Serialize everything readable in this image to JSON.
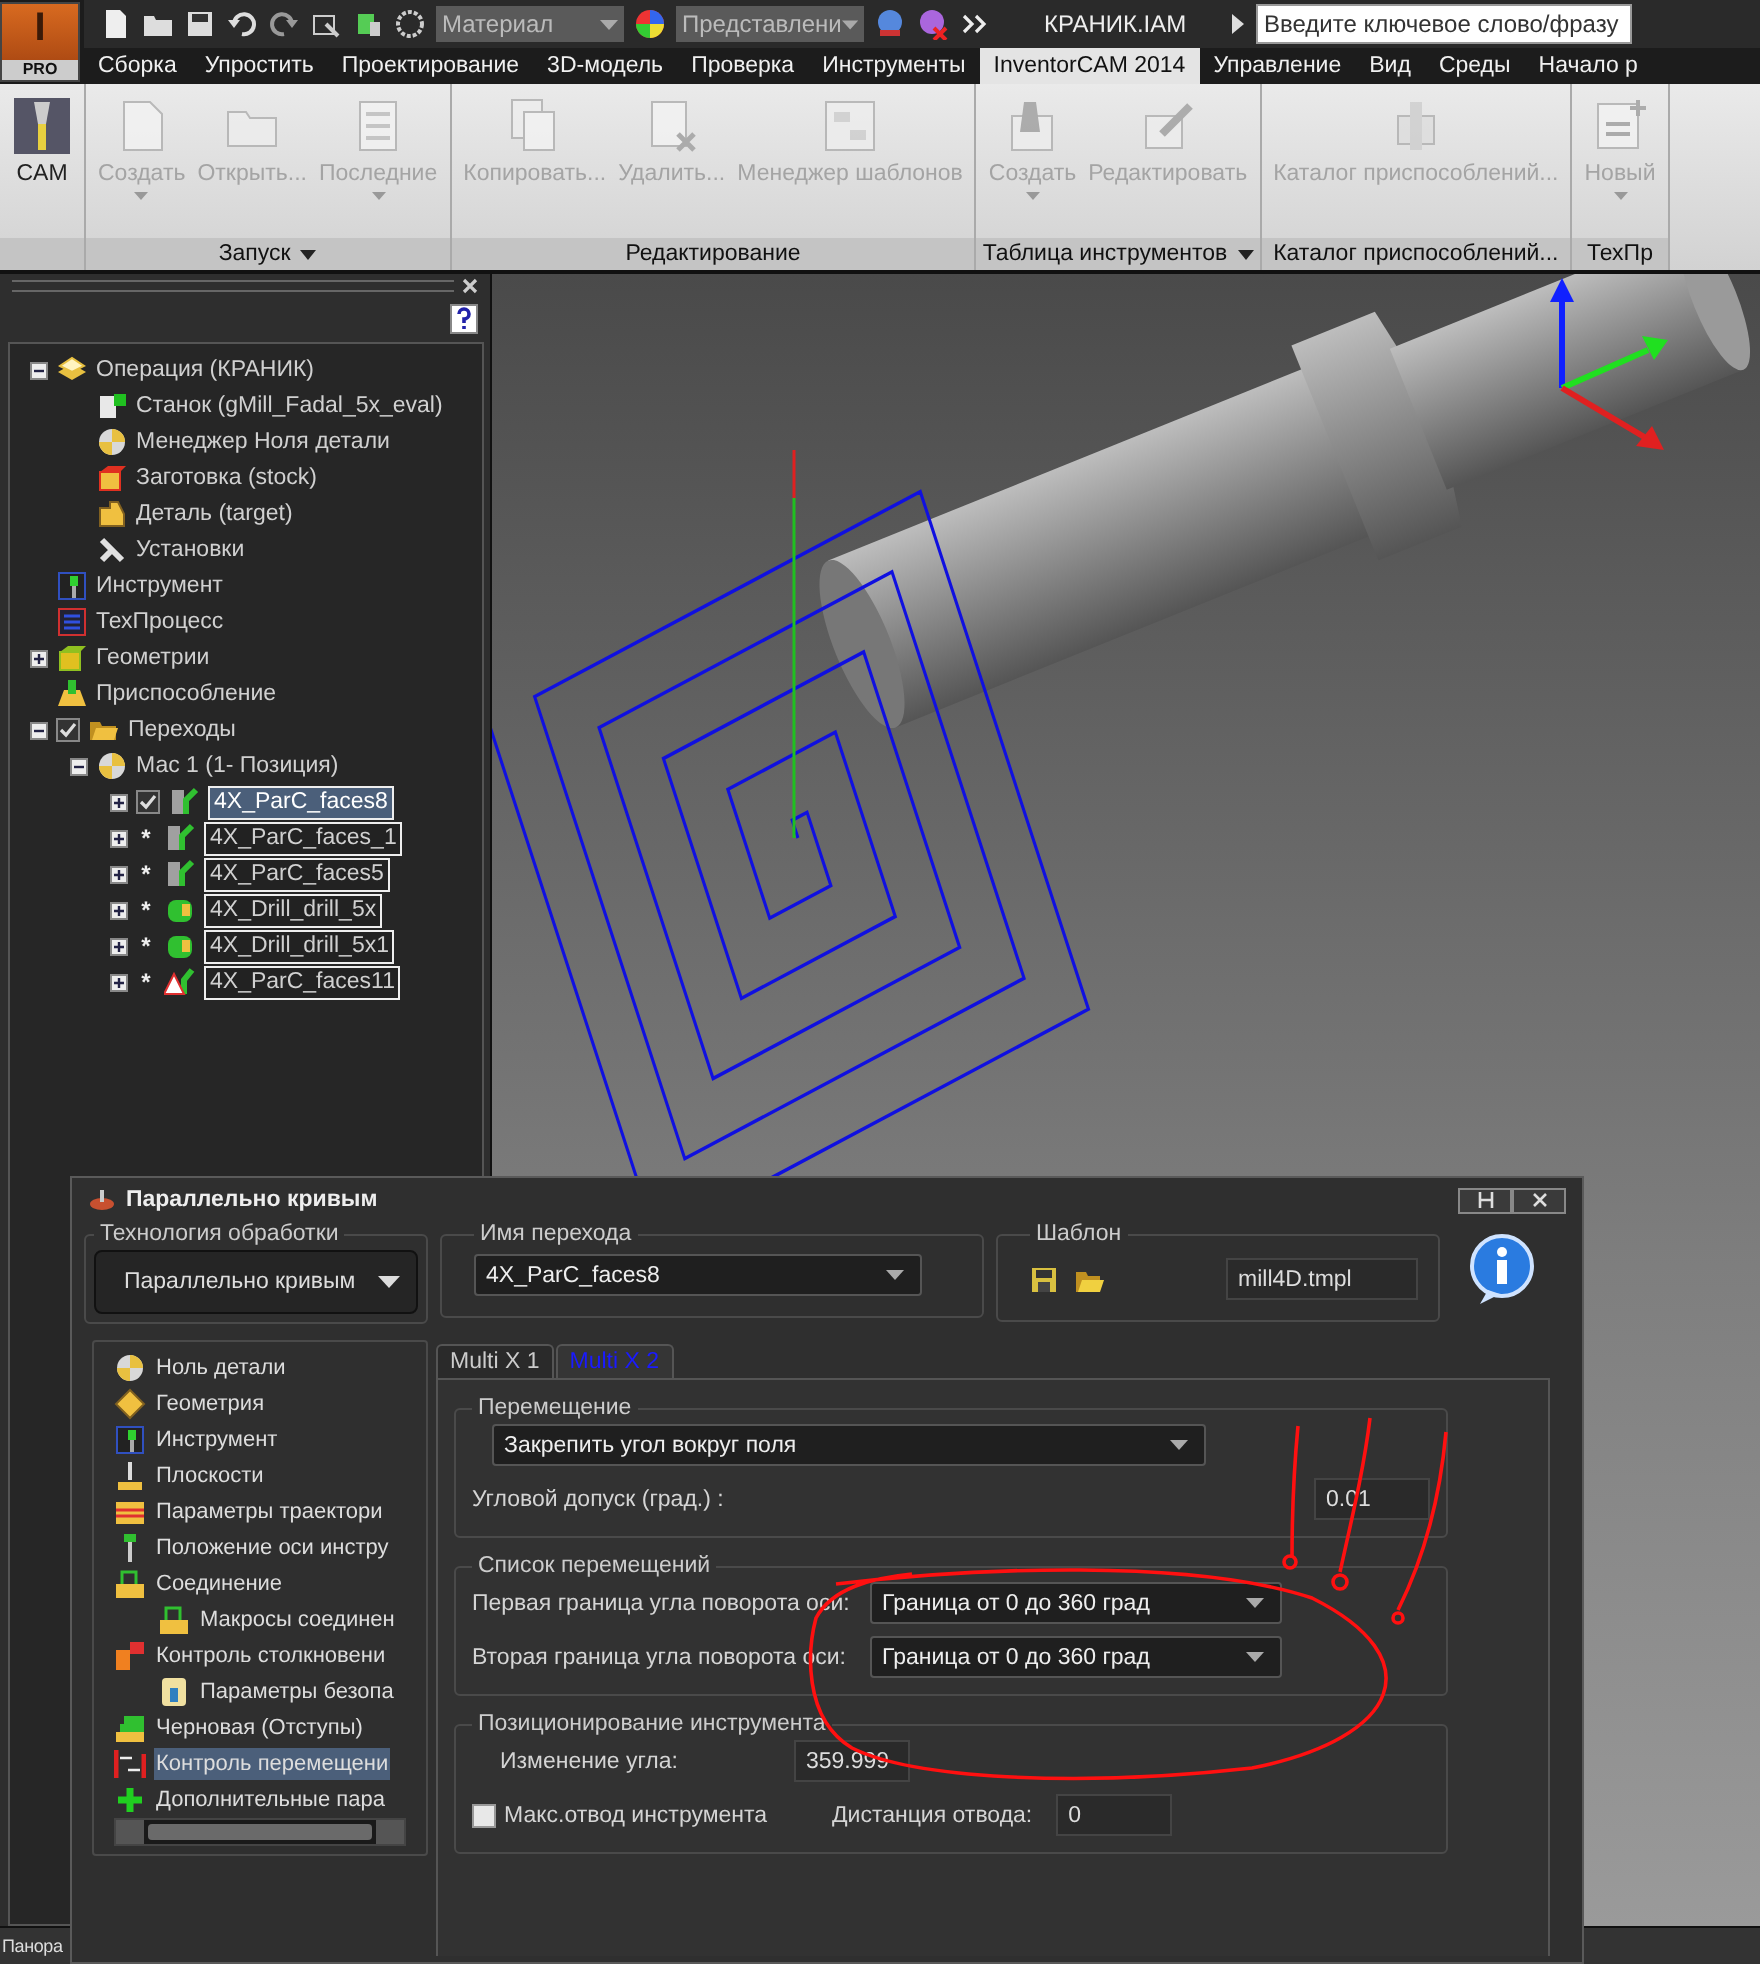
{
  "app_header": {
    "logo_letter": "I",
    "logo_badge": "PRO",
    "material": "Материал",
    "representation": "Представлени",
    "document_title": "КРАНИК.IAM",
    "search": {
      "placeholder": "Введите ключевое слово/фразу"
    }
  },
  "ribbon_tabs": [
    {
      "label": "Сборка",
      "selected": false
    },
    {
      "label": "Упростить",
      "selected": false
    },
    {
      "label": "Проектирование",
      "selected": false
    },
    {
      "label": "3D-модель",
      "selected": false
    },
    {
      "label": "Проверка",
      "selected": false
    },
    {
      "label": "Инструменты",
      "selected": false
    },
    {
      "label": "InventorCAM 2014",
      "selected": true
    },
    {
      "label": "Управление",
      "selected": false
    },
    {
      "label": "Вид",
      "selected": false
    },
    {
      "label": "Среды",
      "selected": false
    },
    {
      "label": "Начало р",
      "selected": false
    }
  ],
  "ribbon_groups": [
    {
      "buttons": [
        {
          "label": "CAM",
          "kind": "cam",
          "disabled": false,
          "dropdown": false
        }
      ]
    },
    {
      "label": "Запуск",
      "menu": true,
      "buttons": [
        {
          "label": "Создать",
          "kind": "document",
          "disabled": true,
          "dropdown": true
        },
        {
          "label": "Открыть...",
          "kind": "folder",
          "disabled": true,
          "dropdown": false
        },
        {
          "label": "Последние",
          "kind": "list",
          "disabled": true,
          "dropdown": true
        }
      ]
    },
    {
      "label": "Редактирование",
      "menu": false,
      "buttons": [
        {
          "label": "Копировать...",
          "kind": "copy",
          "disabled": true,
          "dropdown": false
        },
        {
          "label": "Удалить...",
          "kind": "delete",
          "disabled": true,
          "dropdown": false
        },
        {
          "label": "Менеджер шаблонов",
          "kind": "template",
          "disabled": true,
          "dropdown": false
        }
      ]
    },
    {
      "label": "Таблица инструментов",
      "menu": true,
      "buttons": [
        {
          "label": "Создать",
          "kind": "tool",
          "disabled": true,
          "dropdown": true
        },
        {
          "label": "Редактировать",
          "kind": "edit",
          "disabled": true,
          "dropdown": false
        }
      ]
    },
    {
      "label": "Каталог приспособлений...",
      "menu": false,
      "buttons": [
        {
          "label": "Каталог приспособлений...",
          "kind": "fixture",
          "disabled": true,
          "dropdown": false
        }
      ]
    },
    {
      "label": "ТехПр",
      "menu": false,
      "buttons": [
        {
          "label": "Новый",
          "kind": "new",
          "disabled": true,
          "dropdown": true
        }
      ]
    }
  ],
  "browser": {
    "tree": [
      {
        "label": "Операция (КРАНИК)",
        "kind": "operation",
        "expanded": true,
        "children": [
          {
            "label": "Станок (gMill_Fadal_5x_eval)",
            "kind": "machine"
          },
          {
            "label": "Менеджер Ноля детали",
            "kind": "zero"
          },
          {
            "label": "Заготовка (stock)",
            "kind": "stock"
          },
          {
            "label": "Деталь (target)",
            "kind": "target"
          },
          {
            "label": "Установки",
            "kind": "settings"
          }
        ]
      },
      {
        "label": "Инструмент",
        "kind": "tool"
      },
      {
        "label": "ТехПроцесс",
        "kind": "process"
      },
      {
        "label": "Геометрии",
        "kind": "geometry",
        "expanded": false
      },
      {
        "label": "Приспособление",
        "kind": "fixture"
      },
      {
        "label": "Переходы",
        "kind": "folder",
        "expanded": true,
        "status": {
          "kind": "checkbox",
          "checked": true
        },
        "children": [
          {
            "label": "Мас 1 (1- Позиция)",
            "kind": "zero",
            "expanded": true,
            "children": [
              {
                "label": "4X_ParC_faces8",
                "kind": "parc",
                "expanded": false,
                "selected": true,
                "status": {
                  "kind": "checkbox",
                  "checked": true
                }
              },
              {
                "label": "4X_ParC_faces_1",
                "kind": "parc",
                "expanded": false,
                "selected": false,
                "status": {
                  "kind": "marker",
                  "text": "*"
                }
              },
              {
                "label": "4X_ParC_faces5",
                "kind": "parc",
                "expanded": false,
                "selected": false,
                "status": {
                  "kind": "marker",
                  "text": "*"
                }
              },
              {
                "label": "4X_Drill_drill_5x",
                "kind": "drill",
                "expanded": false,
                "selected": false,
                "status": {
                  "kind": "marker",
                  "text": "*"
                }
              },
              {
                "label": "4X_Drill_drill_5x1",
                "kind": "drill",
                "expanded": false,
                "selected": false,
                "status": {
                  "kind": "marker",
                  "text": "*"
                }
              },
              {
                "label": "4X_ParC_faces11",
                "kind": "parc_warn",
                "expanded": false,
                "selected": false,
                "status": {
                  "kind": "marker",
                  "text": "*"
                }
              }
            ]
          }
        ]
      }
    ]
  },
  "dialog": {
    "title": "Параллельно кривым",
    "technology": {
      "legend": "Технология обработки",
      "value": "Параллельно кривым"
    },
    "operation_name": {
      "legend": "Имя перехода",
      "value": "4X_ParC_faces8"
    },
    "template": {
      "legend": "Шаблон",
      "value": "mill4D.tmpl"
    },
    "nav": [
      {
        "label": "Ноль детали",
        "kind": "zero",
        "selected": false
      },
      {
        "label": "Геометрия",
        "kind": "diamond",
        "selected": false
      },
      {
        "label": "Инструмент",
        "kind": "tool",
        "selected": false
      },
      {
        "label": "Плоскости",
        "kind": "planes",
        "selected": false
      },
      {
        "label": "Параметры траектори",
        "kind": "layers",
        "selected": false
      },
      {
        "label": "Положение оси инстру",
        "kind": "axis",
        "selected": false
      },
      {
        "label": "Соединение",
        "kind": "link",
        "selected": false,
        "children": [
          {
            "label": "Макросы соединен",
            "kind": "link",
            "selected": false
          }
        ]
      },
      {
        "label": "Контроль столкновени",
        "kind": "collision",
        "selected": false,
        "children": [
          {
            "label": "Параметры безопа",
            "kind": "safety",
            "selected": false
          }
        ]
      },
      {
        "label": "Черновая (Отступы)",
        "kind": "steps",
        "selected": false
      },
      {
        "label": "Контроль перемещени",
        "kind": "motion",
        "selected": true
      },
      {
        "label": "Дополнительные пара",
        "kind": "plus",
        "selected": false
      }
    ],
    "tabs": [
      {
        "label": "Multi X 1",
        "selected": false
      },
      {
        "label": "Multi X 2",
        "selected": true
      }
    ],
    "motion": {
      "legend": "Перемещение",
      "mode": "Закрепить угол вокруг поля",
      "tolerance_label": "Угловой допуск (град.) :",
      "tolerance": "0.01"
    },
    "motion_list": {
      "legend": "Список перемещений",
      "rows": [
        {
          "label": "Первая граница угла поворота оси:",
          "value": "Граница от 0 до 360 град"
        },
        {
          "label": "Вторая граница угла поворота оси:",
          "value": "Граница от 0 до 360 град"
        }
      ]
    },
    "positioning": {
      "legend": "Позиционирование инструмента",
      "angle_label": "Изменение угла:",
      "angle": "359.999",
      "max_retract": {
        "label": "Макс.отвод инструмента",
        "checked": false
      },
      "distance_label": "Дистанция отвода:",
      "distance": "0"
    }
  },
  "status_bar": "Панора"
}
